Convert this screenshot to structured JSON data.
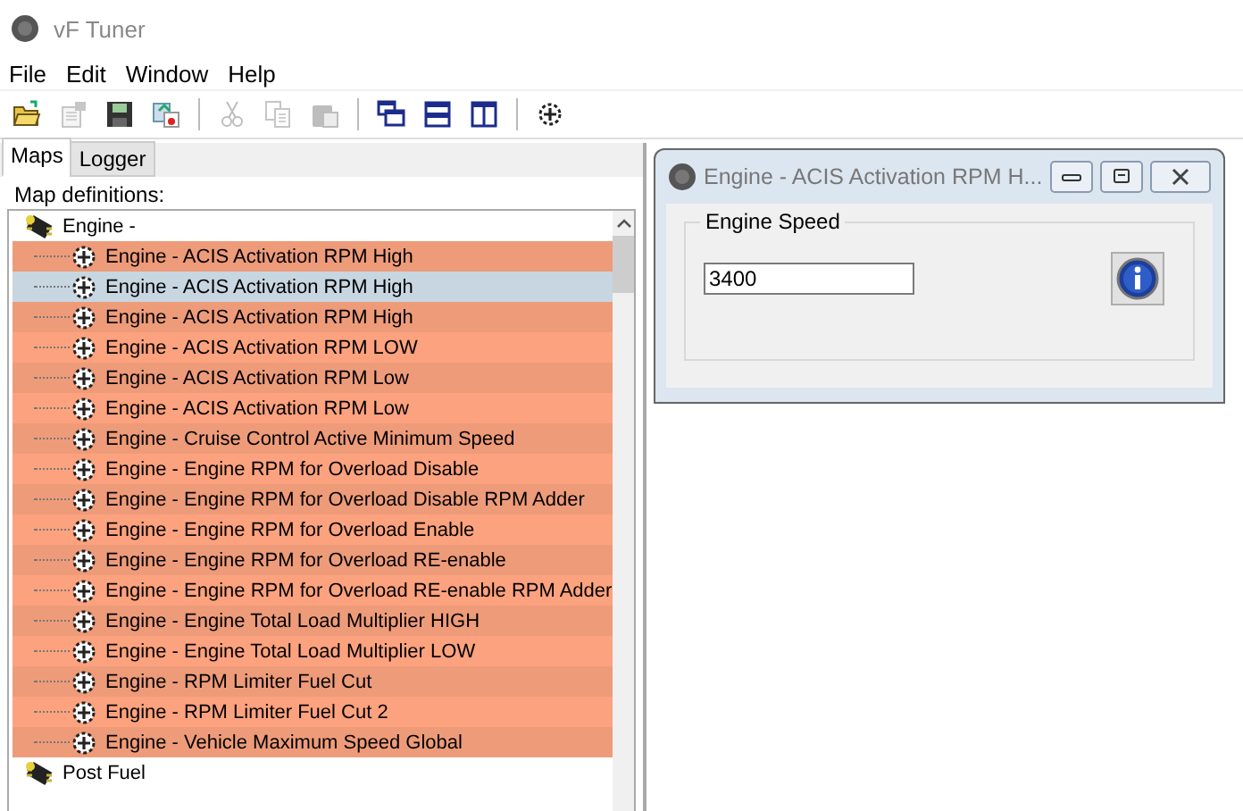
{
  "window": {
    "title": "vF Tuner"
  },
  "menu": [
    "File",
    "Edit",
    "Window",
    "Help"
  ],
  "toolbar": [
    {
      "kind": "open",
      "disabled": false
    },
    {
      "kind": "properties",
      "disabled": true
    },
    {
      "kind": "save",
      "disabled": false
    },
    {
      "kind": "import",
      "disabled": false
    },
    {
      "kind": "sep"
    },
    {
      "kind": "cut",
      "disabled": true
    },
    {
      "kind": "copy",
      "disabled": true
    },
    {
      "kind": "paste",
      "disabled": true
    },
    {
      "kind": "sep"
    },
    {
      "kind": "cascade",
      "disabled": false
    },
    {
      "kind": "tile-h",
      "disabled": false
    },
    {
      "kind": "tile-v",
      "disabled": false
    },
    {
      "kind": "sep"
    },
    {
      "kind": "gear",
      "disabled": false
    }
  ],
  "tabs": [
    {
      "label": "Maps",
      "selected": true
    },
    {
      "label": "Logger",
      "selected": false
    }
  ],
  "map_definitions": {
    "label": "Map definitions:",
    "tree": [
      {
        "label": "Engine -",
        "children": [
          {
            "label": "Engine - ACIS Activation RPM High",
            "selected": false
          },
          {
            "label": "Engine - ACIS Activation RPM High",
            "selected": true
          },
          {
            "label": "Engine - ACIS Activation RPM High",
            "selected": false
          },
          {
            "label": "Engine - ACIS Activation RPM LOW",
            "selected": false
          },
          {
            "label": "Engine - ACIS Activation RPM Low",
            "selected": false
          },
          {
            "label": "Engine - ACIS Activation RPM Low",
            "selected": false
          },
          {
            "label": "Engine - Cruise Control Active Minimum Speed",
            "selected": false
          },
          {
            "label": "Engine - Engine RPM for Overload Disable",
            "selected": false
          },
          {
            "label": "Engine - Engine RPM for Overload Disable RPM Adder",
            "selected": false
          },
          {
            "label": "Engine - Engine RPM for Overload Enable",
            "selected": false
          },
          {
            "label": "Engine - Engine RPM for Overload RE-enable",
            "selected": false
          },
          {
            "label": "Engine - Engine RPM for Overload RE-enable RPM Adder",
            "selected": false
          },
          {
            "label": "Engine - Engine Total Load Multiplier HIGH",
            "selected": false
          },
          {
            "label": "Engine - Engine Total Load Multiplier LOW",
            "selected": false
          },
          {
            "label": "Engine - RPM Limiter Fuel Cut",
            "selected": false
          },
          {
            "label": "Engine - RPM Limiter Fuel Cut 2",
            "selected": false
          },
          {
            "label": "Engine - Vehicle Maximum Speed Global",
            "selected": false
          }
        ]
      },
      {
        "label": "Post Fuel"
      }
    ]
  },
  "child_window": {
    "title": "Engine - ACIS Activation RPM H...",
    "group_label": "Engine Speed",
    "value": "3400"
  }
}
